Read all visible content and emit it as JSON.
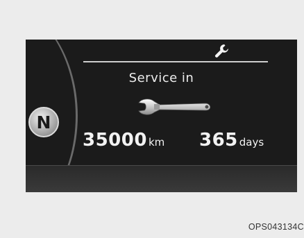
{
  "display": {
    "gear_indicator": "N",
    "title": "Service in",
    "distance_value": "35000",
    "distance_unit": "km",
    "days_value": "365",
    "days_unit": "days",
    "icons": [
      "wrench-icon",
      "wrench-icon"
    ]
  },
  "caption": {
    "code": "OPS043134C"
  },
  "colors": {
    "screen_background": "#1b1b1b",
    "text": "#f2f2f2",
    "page_background": "#ececec"
  }
}
